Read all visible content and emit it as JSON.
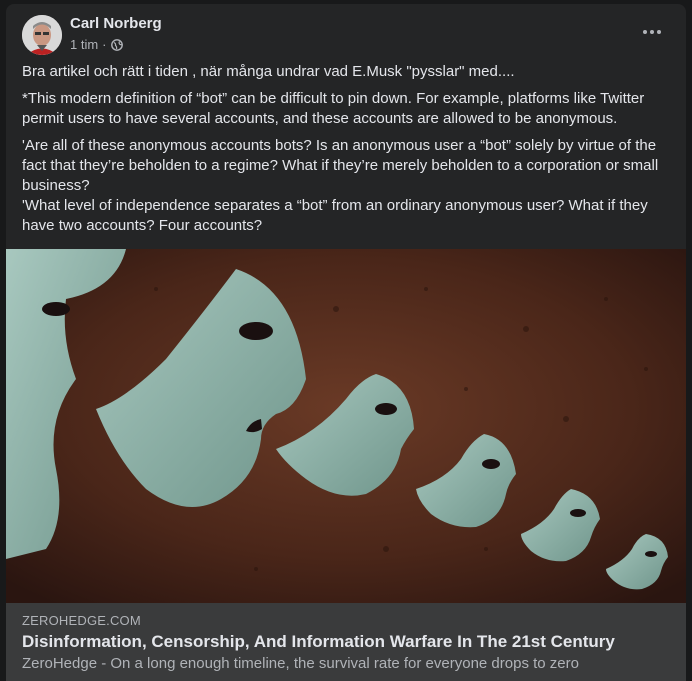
{
  "post": {
    "author": "Carl Norberg",
    "time": "1 tim",
    "separator": "·",
    "privacy_icon": "globe-icon",
    "more_icon": "more-dots-icon",
    "paragraphs": [
      "Bra artikel och rätt i tiden , när många undrar vad E.Musk \"pysslar\" med....",
      "*This modern definition of “bot” can be difficult to pin down. For example, platforms like Twitter permit users to have several accounts, and these accounts are allowed to be anonymous.",
      "'Are all of these anonymous accounts bots? Is an anonymous user a “bot” solely by virtue of the fact that they’re beholden to a regime? What if they’re merely beholden to a corporation or small business?",
      "'What level of independence separates a “bot” from an ordinary anonymous user? What if they have two accounts? Four accounts?"
    ]
  },
  "link": {
    "domain": "ZEROHEDGE.COM",
    "title": "Disinformation, Censorship, And Information Warfare In The 21st Century",
    "description": "ZeroHedge - On a long enough timeline, the survival rate for everyone drops to zero"
  },
  "colors": {
    "page_bg": "#18191a",
    "card_bg": "#242526",
    "link_bg": "#3a3b3c",
    "primary_text": "#e4e6eb",
    "secondary_text": "#b0b3b8",
    "mask_color": "#8fb3aa",
    "image_bg": "#4a2518"
  }
}
